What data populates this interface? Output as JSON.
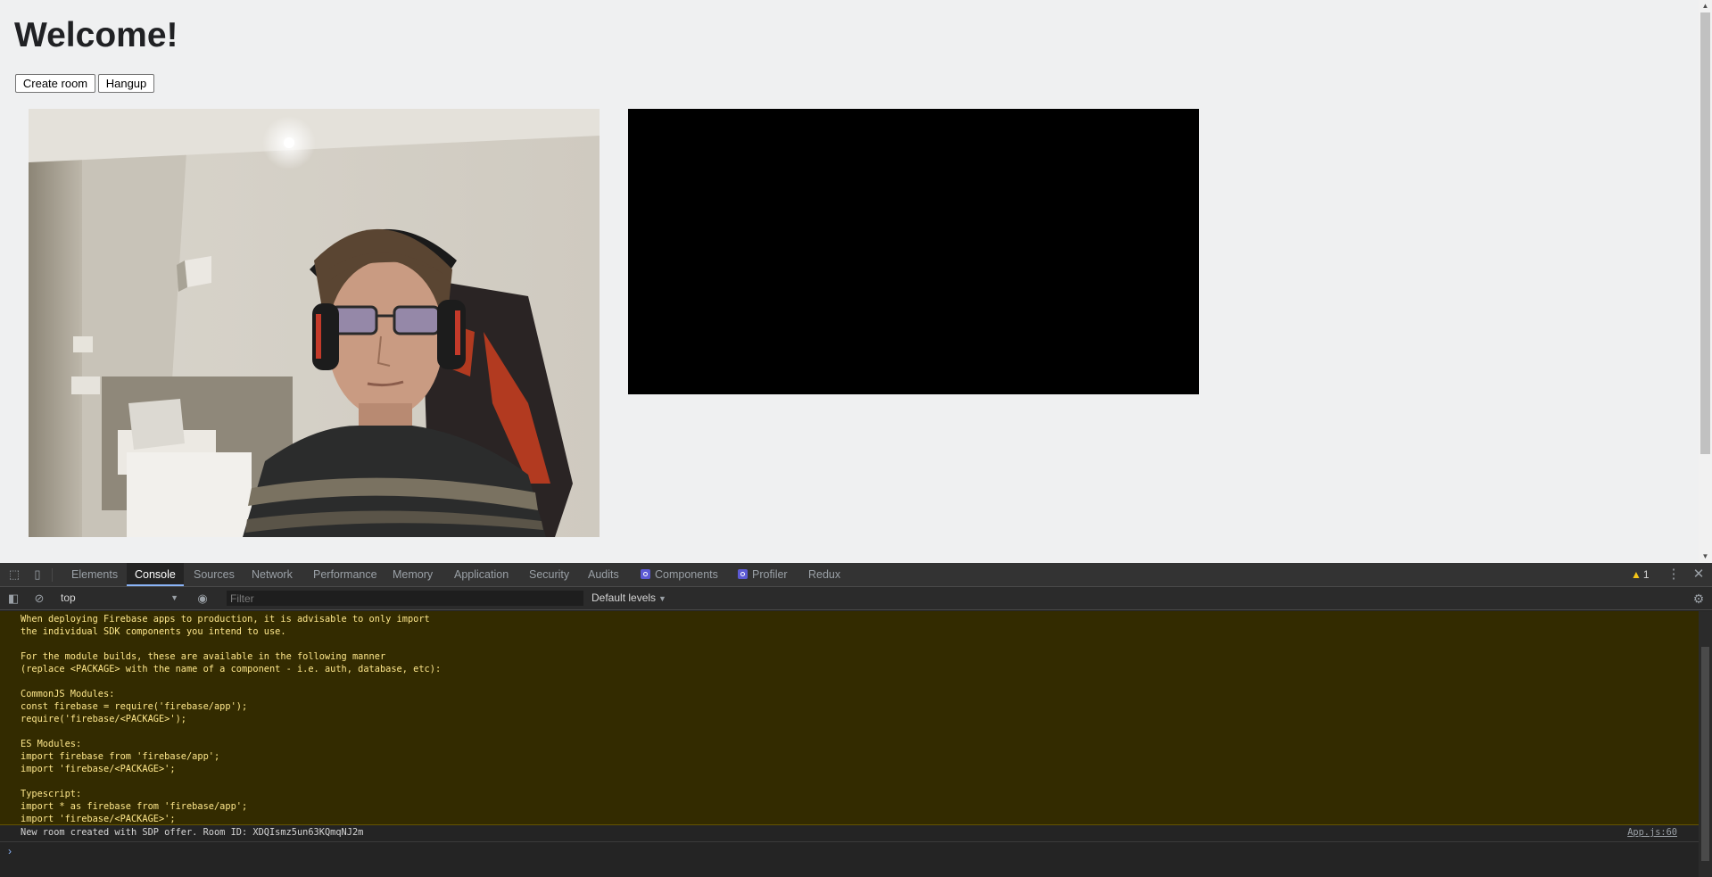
{
  "page": {
    "heading": "Welcome!",
    "buttons": {
      "create_room": "Create room",
      "hangup": "Hangup"
    }
  },
  "devtools": {
    "tabs": [
      {
        "label": "Elements"
      },
      {
        "label": "Console",
        "active": true
      },
      {
        "label": "Sources"
      },
      {
        "label": "Network"
      },
      {
        "label": "Performance"
      },
      {
        "label": "Memory"
      },
      {
        "label": "Application"
      },
      {
        "label": "Security"
      },
      {
        "label": "Audits"
      },
      {
        "label": "Components",
        "icon": "react-icon"
      },
      {
        "label": "Profiler",
        "icon": "react-icon"
      },
      {
        "label": "Redux"
      }
    ],
    "warning_count": "1",
    "toolbar": {
      "context": "top",
      "filter_placeholder": "Filter",
      "levels": "Default levels"
    },
    "console": {
      "warning_lines": [
        "When deploying Firebase apps to production, it is advisable to only import",
        "the individual SDK components you intend to use.",
        "",
        "For the module builds, these are available in the following manner",
        "(replace <PACKAGE> with the name of a component - i.e. auth, database, etc):",
        "",
        "CommonJS Modules:",
        "const firebase = require('firebase/app');",
        "require('firebase/<PACKAGE>');",
        "",
        "ES Modules:",
        "import firebase from 'firebase/app';",
        "import 'firebase/<PACKAGE>';",
        "",
        "Typescript:",
        "import * as firebase from 'firebase/app';",
        "import 'firebase/<PACKAGE>';"
      ],
      "log_message": "New room created with SDP offer. Room ID: XDQIsmz5un63KQmqNJ2m",
      "log_source": "App.js:60"
    }
  },
  "colors": {
    "page_bg": "#eff0f1",
    "devtools_bg": "#242424",
    "warning_bg": "#332b00",
    "warning_text": "#fde68a",
    "accent": "#8ab4f8"
  }
}
